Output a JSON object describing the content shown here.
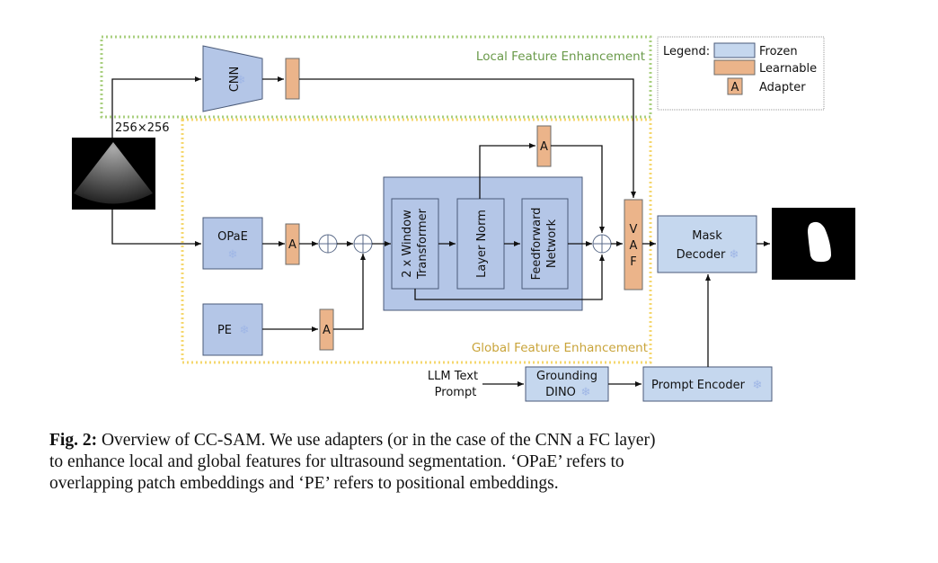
{
  "diagram": {
    "regions": {
      "local": "Local Feature Enhancement",
      "global": "Global Feature Enhancement"
    },
    "legend": {
      "title": "Legend:",
      "frozen": "Frozen",
      "learnable": "Learnable",
      "adapter_glyph": "A",
      "adapter": "Adapter"
    },
    "input_size": "256×256",
    "blocks": {
      "cnn": "CNN",
      "opae": "OPaE",
      "pe": "PE",
      "adapter": "A",
      "window_transformer_1": "2 x Window",
      "window_transformer_2": "Transformer",
      "layer_norm": "Layer Norm",
      "ffn_1": "Feedforward",
      "ffn_2": "Network",
      "vaf_v": "V",
      "vaf_a": "A",
      "vaf_f": "F",
      "mask_decoder_1": "Mask",
      "mask_decoder_2": "Decoder",
      "llm_1": "LLM Text",
      "llm_2": "Prompt",
      "grounding_1": "Grounding",
      "grounding_2": "DINO",
      "prompt_encoder": "Prompt Encoder"
    },
    "frozen_icon": "❄",
    "colors": {
      "frozen": "#b4c6e7",
      "learnable": "#ebb48a",
      "local_border": "#a9cf7f",
      "global_border": "#f5d76e",
      "local_text": "#6a9a4a",
      "global_text": "#c9a43a"
    }
  },
  "caption": {
    "label": "Fig. 2:",
    "text_line1": " Overview of CC-SAM. We use adapters (or in the case of the CNN a FC layer)",
    "text_line2": "to enhance local and global features for ultrasound segmentation. ‘OPaE’ refers to",
    "text_line3": "overlapping patch embeddings and ‘PE’ refers to positional embeddings."
  }
}
